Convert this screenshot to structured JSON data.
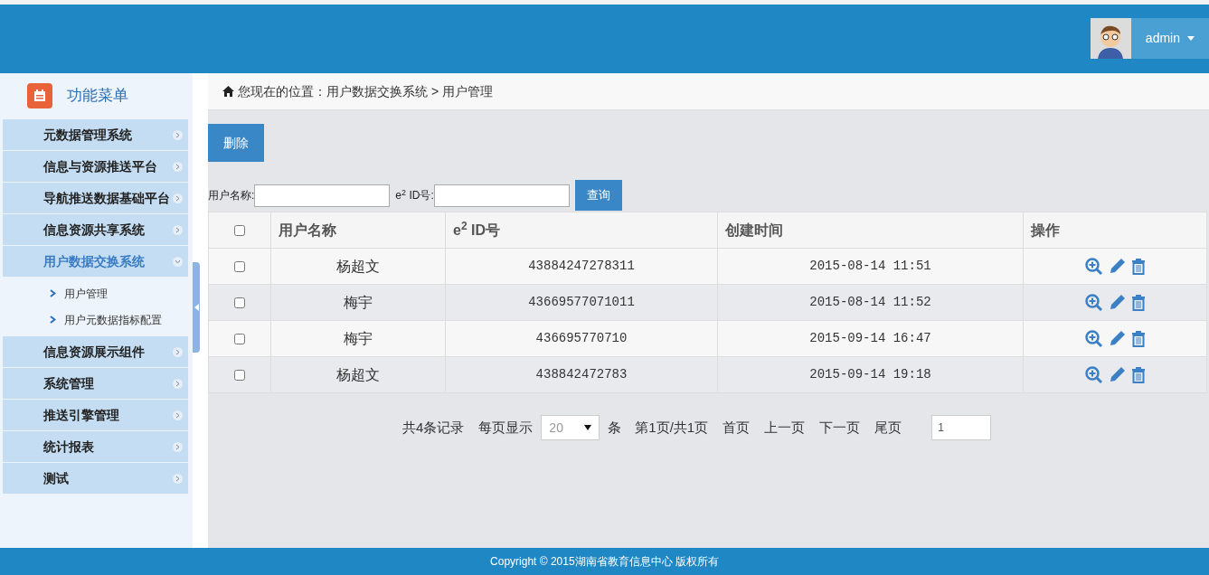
{
  "header": {
    "user": {
      "name": "admin"
    }
  },
  "sidebar": {
    "title": "功能菜单",
    "items": [
      {
        "label": "元数据管理系统",
        "expanded": false
      },
      {
        "label": "信息与资源推送平台",
        "expanded": false
      },
      {
        "label": "导航推送数据基础平台",
        "expanded": false
      },
      {
        "label": "信息资源共享系统",
        "expanded": false
      },
      {
        "label": "用户数据交换系统",
        "expanded": true,
        "children": [
          {
            "label": "用户管理"
          },
          {
            "label": "用户元数据指标配置"
          }
        ]
      },
      {
        "label": "信息资源展示组件",
        "expanded": false
      },
      {
        "label": "系统管理",
        "expanded": false
      },
      {
        "label": "推送引擎管理",
        "expanded": false
      },
      {
        "label": "统计报表",
        "expanded": false
      },
      {
        "label": "测试",
        "expanded": false
      }
    ]
  },
  "breadcrumb": "您现在的位置：用户数据交换系统 > 用户管理",
  "toolbar": {
    "delete_button": "删除"
  },
  "search": {
    "fields": [
      {
        "label": "用户名称:"
      },
      {
        "label": "e$^{2}$ ID号:"
      }
    ],
    "button": "查询"
  },
  "table": {
    "select_all": {
      "checked": false
    },
    "columns": [
      "用户名称",
      "e$^{2}$ ID号",
      "创建时间",
      "操作"
    ],
    "rows": [
      {
        "checked": false,
        "name": "杨超文",
        "id": "43884247278311",
        "created": "2015-08-14 11:51"
      },
      {
        "checked": false,
        "name": "梅宇",
        "id": "43669577071011",
        "created": "2015-08-14 11:52"
      },
      {
        "checked": false,
        "name": "梅宇",
        "id": "436695770710",
        "created": "2015-09-14 16:47"
      },
      {
        "checked": false,
        "name": "杨超文",
        "id": "438842472783",
        "created": "2015-09-14 19:18"
      }
    ]
  },
  "pagination": {
    "total": "共4条记录",
    "per_page_label": "每页显示",
    "per_page_value": "20",
    "unit": "条",
    "page_info": "第1页/共1页",
    "first": "首页",
    "prev": "上一页",
    "next": "下一页",
    "last": "尾页",
    "page_input": "1"
  },
  "footer": "Copyright © 2015湖南省教育信息中心 版权所有"
}
